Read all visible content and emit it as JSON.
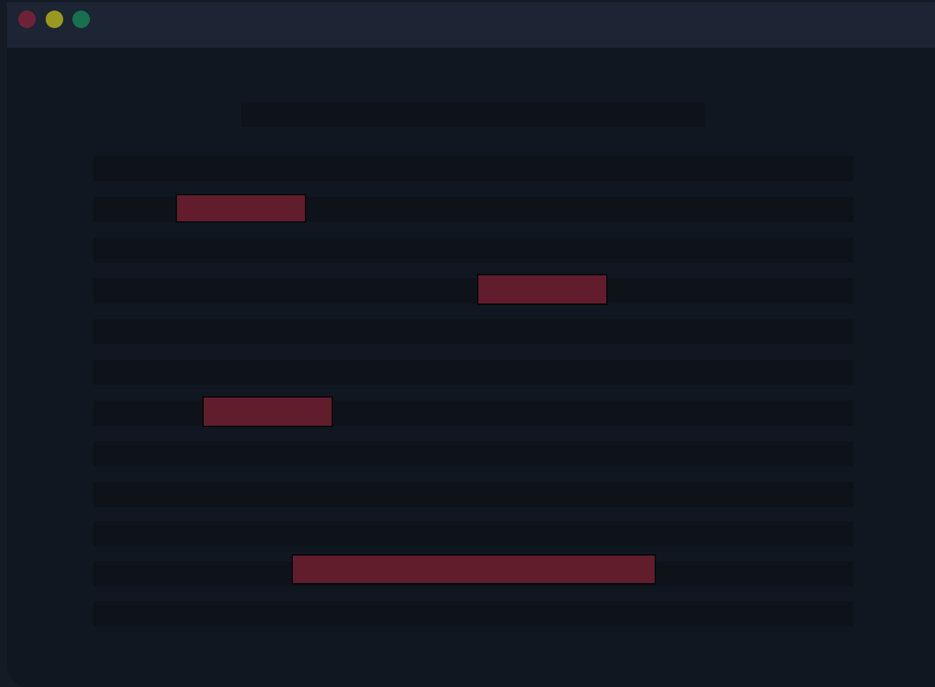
{
  "window": {
    "controls": [
      {
        "name": "close",
        "color": "#6e2237"
      },
      {
        "name": "minimize",
        "color": "#9a991f"
      },
      {
        "name": "maximize",
        "color": "#17704e"
      }
    ]
  },
  "heading": {
    "text": ""
  },
  "rows_count": 12,
  "highlights": [
    {
      "row": 1,
      "label": ""
    },
    {
      "row": 3,
      "label": ""
    },
    {
      "row": 6,
      "label": ""
    },
    {
      "row": 10,
      "label": ""
    }
  ],
  "accent_color": "#621d2d"
}
